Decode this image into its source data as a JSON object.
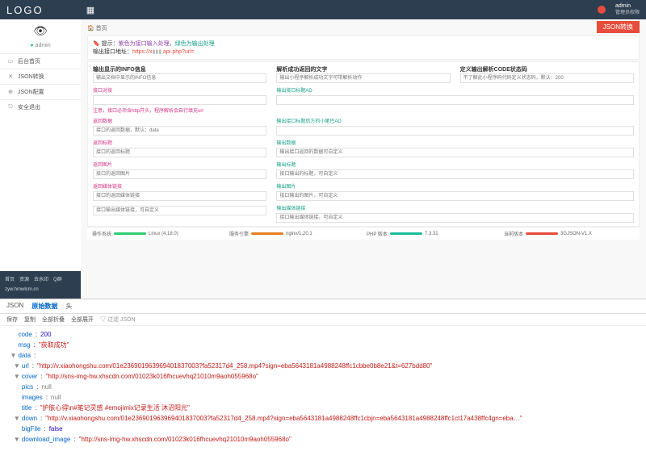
{
  "topbar": {
    "logo": "LOGO",
    "admin_name": "admin",
    "admin_role": "管理员权限"
  },
  "badge": "JSON转换",
  "sidebar": {
    "user": "admin",
    "items": [
      {
        "icon": "▭",
        "label": "后台首页"
      },
      {
        "icon": "✕",
        "label": "JSON转换"
      },
      {
        "icon": "⊕",
        "label": "JSON配置"
      },
      {
        "icon": "⎋",
        "label": "安全退出"
      }
    ],
    "footer_links": [
      "首页",
      "资源",
      "去水印",
      "Q群"
    ],
    "footer_domain": "zyw.hmwlcm.cn"
  },
  "crumb_home": "首页",
  "tip": {
    "prefix": "提示：",
    "purple": "紫色为接口输入处理，",
    "green": "绿色为输出处理",
    "addr_label": "输出接口地址：",
    "addr_host": "https://x",
    "addr_path": "api.php?url="
  },
  "col_heads": [
    "输出显示的INFO信息",
    "解析成功返回的文字",
    "定义输出解析CODE状态码"
  ],
  "col_placeholders": [
    "输出文档中显示的INFO信息",
    "输出小程序解析成功文字可带解析动作",
    "不了解此小程序码代码定义状态码，默认：200"
  ],
  "rows": [
    {
      "left": {
        "cls": "pink",
        "label": "接口对接",
        "ph": ""
      },
      "right": {
        "cls": "green",
        "label": "输出接口标题AD",
        "ph": ""
      },
      "note": "注意，接口必须含http开头，程序解析会自行填充url"
    },
    {
      "left": {
        "cls": "pink",
        "label": "返回数据",
        "ph": "接口的返回数据，默认：data"
      },
      "right": {
        "cls": "green",
        "label": "输出接口标题后方的小尾巴AD",
        "ph": ""
      }
    },
    {
      "left": {
        "cls": "pink",
        "label": "返回标题",
        "ph": "接口的返回标题"
      },
      "right": {
        "cls": "green",
        "label": "输出数据",
        "ph": "输出接口返回的数据可自定义"
      }
    },
    {
      "left": {
        "cls": "pink",
        "label": "返回图片",
        "ph": "接口的返回图片"
      },
      "right": {
        "cls": "green",
        "label": "输出标题",
        "ph": "接口输出的标题，可自定义"
      }
    },
    {
      "left": {
        "cls": "pink",
        "label": "返回媒体链接",
        "ph": "接口的返回媒体链接"
      },
      "right": {
        "cls": "green",
        "label": "输出图片",
        "ph": "接口输出的图片，可自定义"
      }
    },
    {
      "left": {
        "cls": "pink",
        "label": "",
        "ph": "接口输出媒体链接，可自定义"
      },
      "right": {
        "cls": "green",
        "label": "输出媒体链接",
        "ph": "接口输出媒体链接，可自定义"
      }
    }
  ],
  "status": [
    {
      "label": "操作系统",
      "bar": "b-green",
      "val": "Linux (4.18.0)"
    },
    {
      "label": "服务引擎",
      "bar": "b-orange",
      "val": "nginx/1.20.1"
    },
    {
      "label": "PHP 版本",
      "bar": "b-teal",
      "val": "7.3.31"
    },
    {
      "label": "当前版本",
      "bar": "b-red",
      "val": "3GJSON-V1.X"
    }
  ],
  "devtools": {
    "tabs": [
      "JSON",
      "原始数据",
      "头"
    ],
    "tools": [
      "保存",
      "复制",
      "全部折叠",
      "全部展开"
    ],
    "filter_label": "过滤 JSON",
    "json": [
      {
        "d": 0,
        "t": "",
        "k": "code",
        "v": "200",
        "vt": "num"
      },
      {
        "d": 0,
        "t": "",
        "k": "msg",
        "v": "\"获取成功\"",
        "vt": "str"
      },
      {
        "d": 0,
        "t": "▼",
        "k": "data",
        "v": "",
        "vt": ""
      },
      {
        "d": 1,
        "t": "▼",
        "k": "url",
        "v": "\"http://v.xiaohongshu.com/01e236901963969401837003?fa52317d4_258.mp4?sign=eba5643181a4988248ffc1cbbe0b8e21&t=627bdd80\"",
        "vt": "str"
      },
      {
        "d": 1,
        "t": "▼",
        "k": "cover",
        "v": "\"http://sns-img-hw.xhscdn.com/01023k016fhcuevhq21010m9aoh055968o\"",
        "vt": "str"
      },
      {
        "d": 1,
        "t": "",
        "k": "pics",
        "v": "null",
        "vt": "null"
      },
      {
        "d": 1,
        "t": "",
        "k": "images",
        "v": "null",
        "vt": "null"
      },
      {
        "d": 1,
        "t": "",
        "k": "title",
        "v": "\"护肤心得\\n#笔记灵感   #emojimix记录生活    沐沼阳光\"",
        "vt": "str"
      },
      {
        "d": 1,
        "t": "▼",
        "k": "down",
        "v": "\"http://v.xiaohongshu.com/01e236901963969401837003?fa52317d4_258.mp4?sign=eba5643181a4988248ffc1cbjn=eba5643181a4988248ffc1ct17a438ffc4gn=eba…\"",
        "vt": "str"
      },
      {
        "d": 1,
        "t": "",
        "k": "bigFile",
        "v": "false",
        "vt": "bool"
      },
      {
        "d": 1,
        "t": "▼",
        "k": "download_image",
        "v": "\"http://sns-img-hw.xhscdn.com/01023k016fhcuevhq21010m9aoh055968o\"",
        "vt": "str"
      }
    ]
  }
}
